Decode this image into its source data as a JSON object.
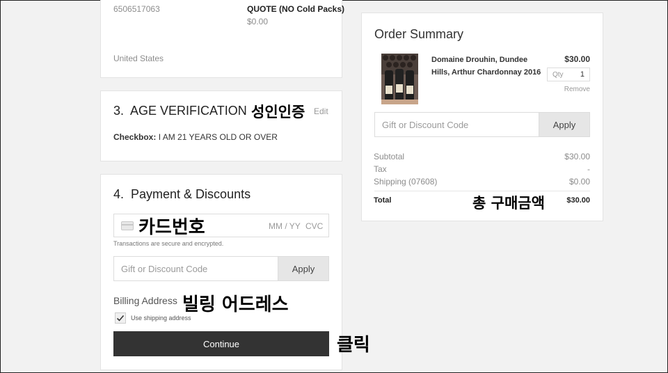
{
  "shipping_card": {
    "phone": "6506517063",
    "method_name": "QUOTE (NO Cold Packs)",
    "method_price": "$0.00",
    "country": "United States"
  },
  "age_section": {
    "title": "3.  AGE VERIFICATION",
    "annotation": "성인인증",
    "edit_label": "Edit",
    "checkbox_label": "Checkbox:",
    "checkbox_value": "I AM 21 YEARS OLD OR OVER"
  },
  "payment_section": {
    "title": "4.  Payment & Discounts",
    "card_annotation": "카드번호",
    "expiry_placeholder": "MM / YY",
    "cvc_placeholder": "CVC",
    "secure_note": "Transactions are secure and encrypted.",
    "discount_placeholder": "Gift or Discount Code",
    "apply_label": "Apply",
    "billing_label": "Billing Address",
    "billing_annotation": "빌링 어드레스",
    "use_shipping_label": "Use shipping address",
    "use_shipping_checked": true,
    "continue_label": "Continue",
    "continue_annotation": "클릭"
  },
  "order_summary": {
    "title": "Order Summary",
    "item": {
      "name": "Domaine Drouhin, Dundee Hills, Arthur Chardonnay 2016",
      "price": "$30.00",
      "qty_label": "Qty",
      "qty": "1",
      "remove_label": "Remove"
    },
    "discount_placeholder": "Gift or Discount Code",
    "apply_label": "Apply",
    "subtotal_label": "Subtotal",
    "subtotal_value": "$30.00",
    "tax_label": "Tax",
    "tax_value": "-",
    "shipping_label": "Shipping (07608)",
    "shipping_value": "$0.00",
    "total_label": "Total",
    "total_annotation": "총 구매금액",
    "total_value": "$30.00"
  }
}
